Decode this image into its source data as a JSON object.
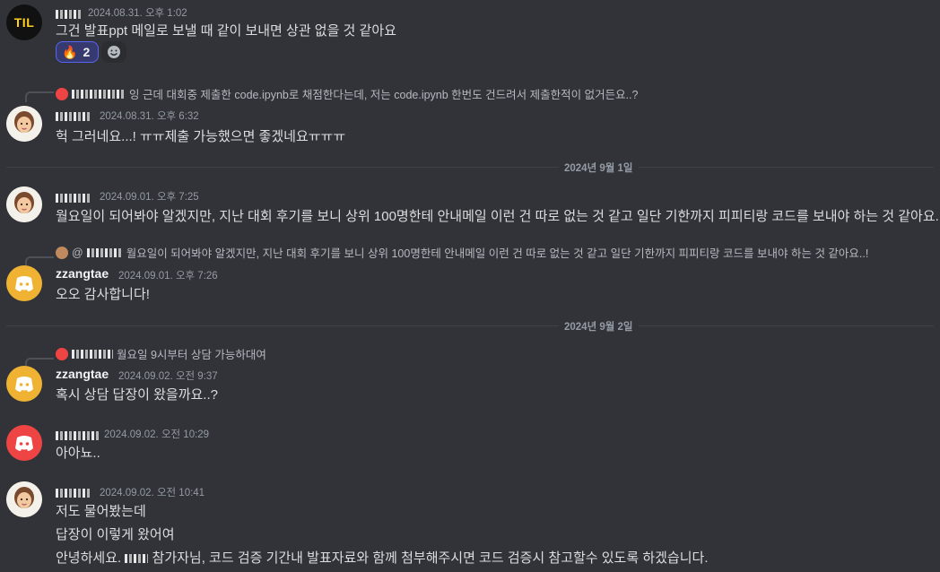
{
  "messages": [
    {
      "timestamp": "2024.08.31. 오후 1:02",
      "text": "그건 발표ppt 메일로 보낼 때 같이 보내면 상관 없을 것 같아요",
      "reaction": {
        "emoji": "🔥",
        "count": "2"
      }
    },
    {
      "reply": "잉 근데 대회중 제출한 code.ipynb로 채점한다는데, 저는 code.ipynb 한번도 건드려서 제출한적이 없거든요..?",
      "timestamp": "2024.08.31. 오후 6:32",
      "text": "헉 그러네요...! ㅠㅠ제출 가능했으면 좋겠네요ㅠㅠㅠ"
    },
    {
      "timestamp": "2024.09.01. 오후 7:25",
      "text": "월요일이 되어봐야 알겠지만, 지난 대회 후기를 보니 상위 100명한테 안내메일 이런 건 따로 없는 것 같고 일단 기한까지 피피티랑 코드를 보내야 하는 것 같아요..!"
    },
    {
      "reply": "월요일이 되어봐야 알겠지만, 지난 대회 후기를 보니 상위 100명한테 안내메일 이런 건 따로 없는 것 같고 일단 기한까지 피피티랑 코드를 보내야 하는 것 같아요..!",
      "reply_prefix": "@",
      "username": "zzangtae",
      "timestamp": "2024.09.01. 오후 7:26",
      "text": "오오 감사합니다!"
    },
    {
      "reply": "월요일 9시부터 상담 가능하대여",
      "username": "zzangtae",
      "timestamp": "2024.09.02. 오전 9:37",
      "text": "혹시 상담 답장이 왔을까요..?"
    },
    {
      "timestamp": "2024.09.02. 오전 10:29",
      "text": "아아뇨.."
    },
    {
      "timestamp": "2024.09.02. 오전 10:41",
      "lines": [
        "저도 물어봤는데",
        "답장이 이렇게 왔어여",
        "참가자님, 코드 검증 기간내 발표자료와 함께 첨부해주시면 코드 검증시 참고할수 있도록 하겠습니다."
      ],
      "line3_prefix": "안녕하세요."
    }
  ],
  "dividers": [
    "2024년 9월 1일",
    "2024년 9월 2일"
  ],
  "avatars": {
    "til": "TIL"
  },
  "colors": {
    "discord_orange": "#f0b232",
    "discord_red": "#ef4444",
    "reaction_bg": "#373a6e",
    "reaction_border": "#5865f2",
    "background": "#313338"
  }
}
